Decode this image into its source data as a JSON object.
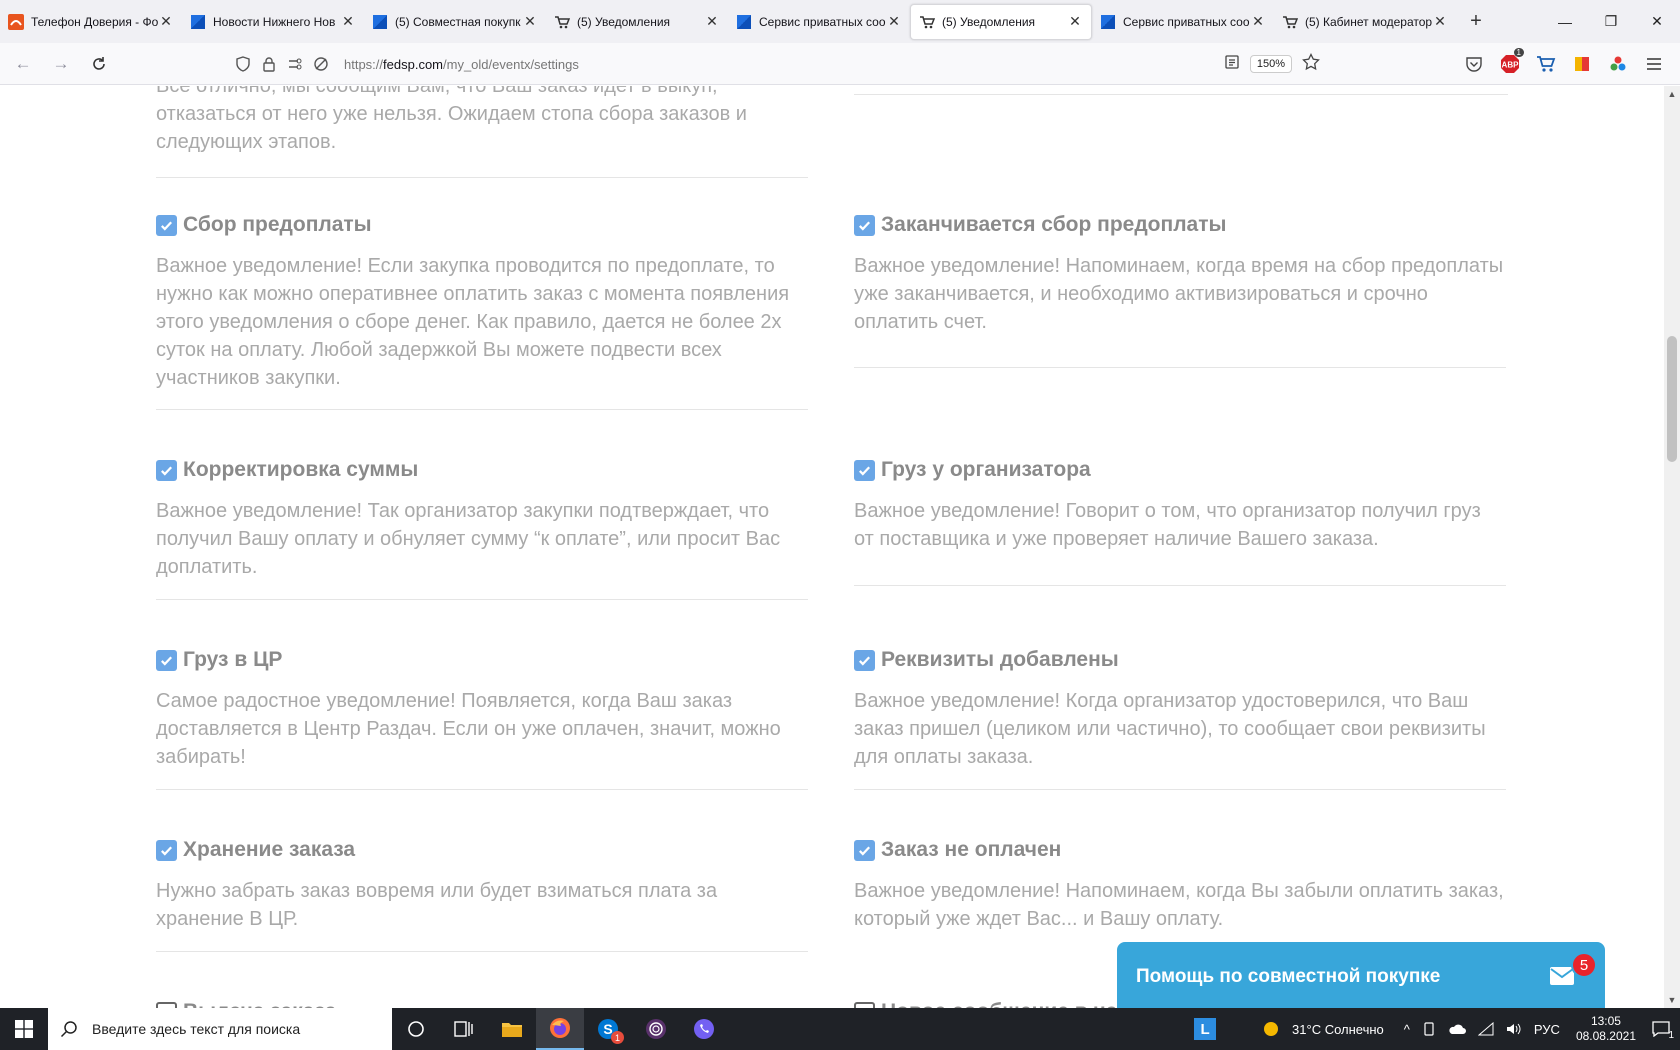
{
  "browser": {
    "tabs": [
      {
        "label": "Телефон Доверия - Фо",
        "icon": "orange-logo-icon"
      },
      {
        "label": "Новости Нижнего Нов",
        "icon": "windows-page-icon"
      },
      {
        "label": "(5) Совместная покупк",
        "icon": "windows-page-icon"
      },
      {
        "label": "(5) Уведомления",
        "icon": "cart-icon"
      },
      {
        "label": "Сервис приватных соо",
        "icon": "windows-page-icon"
      },
      {
        "label": "(5) Уведомления",
        "icon": "cart-icon",
        "active": true
      },
      {
        "label": "Сервис приватных соо",
        "icon": "windows-page-icon"
      },
      {
        "label": "(5) Кабинет модератор",
        "icon": "cart-icon"
      }
    ],
    "url_prefix": "https://",
    "url_domain": "fedsp.com",
    "url_path": "/my_old/eventx/settings",
    "zoom": "150%",
    "abp_badge": "1"
  },
  "content": {
    "top_fragment": "Все отлично, мы сообщим Вам, что Ваш заказ идет в выкуп, отказаться от него уже нельзя. Ожидаем стопа сбора заказов и следующих этапов.",
    "left": [
      {
        "title": "Сбор предоплаты",
        "desc": "Важное уведомление! Если закупка проводится по предоплате, то нужно как можно оперативнее оплатить заказ с момента появления этого уведомления о сборе денег. Как правило, дается не более 2х суток на оплату. Любой задержкой Вы можете подвести всех участников закупки.",
        "checked": true
      },
      {
        "title": "Корректировка суммы",
        "desc": "Важное уведомление! Так организатор закупки подтверждает, что получил Вашу оплату и обнуляет сумму “к оплате”, или просит Вас доплатить.",
        "checked": true
      },
      {
        "title": "Груз в ЦР",
        "desc": "Самое радостное уведомление! Появляется, когда Ваш заказ доставляется в Центр Раздач. Если он уже оплачен, значит, можно забирать!",
        "checked": true
      },
      {
        "title": "Хранение заказа",
        "desc": "Нужно забрать заказ вовремя или будет взиматься плата за хранение В ЦР.",
        "checked": true
      },
      {
        "title": "Выдача заказа",
        "desc": "",
        "checked": false
      }
    ],
    "right": [
      {
        "title": "Заканчивается сбор предоплаты",
        "desc": "Важное уведомление! Напоминаем, когда время на сбор предоплаты уже заканчивается, и необходимо активизироваться и срочно оплатить счет.",
        "checked": true
      },
      {
        "title": "Груз у организатора",
        "desc": "Важное уведомление! Говорит о том, что организатор получил груз от поставщика и уже проверяет наличие Вашего заказа.",
        "checked": true
      },
      {
        "title": "Реквизиты добавлены",
        "desc": "Важное уведомление! Когда организатор удостоверился, что Ваш заказ пришел (целиком или частично), то сообщает свои реквизиты для оплаты заказа.",
        "checked": true
      },
      {
        "title": "Заказ не оплачен",
        "desc": "Важное уведомление! Напоминаем, когда Вы забыли оплатить заказ, который уже ждет Вас... и Вашу оплату.",
        "checked": true
      },
      {
        "title": "Новое сообщение в чате",
        "desc": "",
        "checked": false
      }
    ]
  },
  "help_widget": {
    "label": "Помощь по совместной покупке",
    "badge": "5"
  },
  "taskbar": {
    "search_placeholder": "Введите здесь текст для поиска",
    "skype_badge": "1",
    "weather": "31°C  Солнечно",
    "lang": "РУС",
    "time": "13:05",
    "date": "08.08.2021",
    "notif_count": "1"
  },
  "colors": {
    "checkbox": "#6aa6e6",
    "help_widget": "#38a6da",
    "badge": "#e8232b"
  }
}
